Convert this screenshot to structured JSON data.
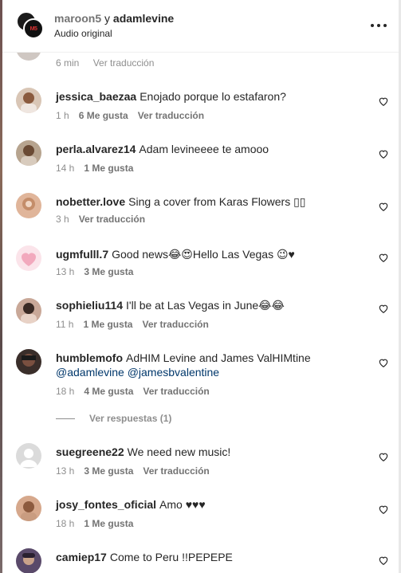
{
  "header": {
    "user1": "maroon5",
    "separator": "y",
    "user2": "adamlevine",
    "subtitle": "Audio original",
    "avatar_text": "M5"
  },
  "partial": {
    "time": "6 min",
    "translate": "Ver traducción"
  },
  "comments": [
    {
      "user": "jessica_baezaa",
      "text": "Enojado porque lo estafaron?",
      "time": "1 h",
      "likes": "6 Me gusta",
      "translate": "Ver traducción",
      "avatar_color": "#d9c6b6"
    },
    {
      "user": "perla.alvarez14",
      "text": "Adam levineeee te amooo",
      "time": "14 h",
      "likes": "1 Me gusta",
      "translate": "",
      "avatar_color": "#b7a48f"
    },
    {
      "user": "nobetter.love",
      "text": "Sing a cover from Karas Flowers ▯▯",
      "time": "3 h",
      "likes": "",
      "translate": "Ver traducción",
      "avatar_color": "#e0b59a"
    },
    {
      "user": "ugmfulll.7",
      "text": "Good news😂😍Hello Las Vegas 😉♥",
      "time": "13 h",
      "likes": "3 Me gusta",
      "translate": "",
      "avatar_color": "#f2c7d2"
    },
    {
      "user": "sophieliu114",
      "text": "I'll be at Las Vegas in June😂😂",
      "time": "11 h",
      "likes": "1 Me gusta",
      "translate": "Ver traducción",
      "avatar_color": "#c9a898"
    },
    {
      "user": "humblemofo",
      "text": "AdHIM Levine and James ValHIMtine",
      "mention1": "@adamlevine",
      "mention2": "@jamesbvalentine",
      "time": "18 h",
      "likes": "4 Me gusta",
      "translate": "Ver traducción",
      "avatar_color": "#3a2e2a"
    },
    {
      "user": "suegreene22",
      "text": "We need new music!",
      "time": "13 h",
      "likes": "3 Me gusta",
      "translate": "Ver traducción",
      "avatar_color": "#dbdbdb"
    },
    {
      "user": "josy_fontes_oficial",
      "text": "Amo ♥♥♥",
      "time": "18 h",
      "likes": "1 Me gusta",
      "translate": "",
      "avatar_color": "#d6a88c"
    },
    {
      "user": "camiep17",
      "text": "Come to Peru !!PEPEPE",
      "time": "",
      "likes": "",
      "translate": "",
      "avatar_color": "#5a4a6a"
    }
  ],
  "replies_label": "Ver respuestas (1)",
  "icons": {
    "heart": "heart-outline-icon",
    "more": "more-horizontal-icon"
  }
}
